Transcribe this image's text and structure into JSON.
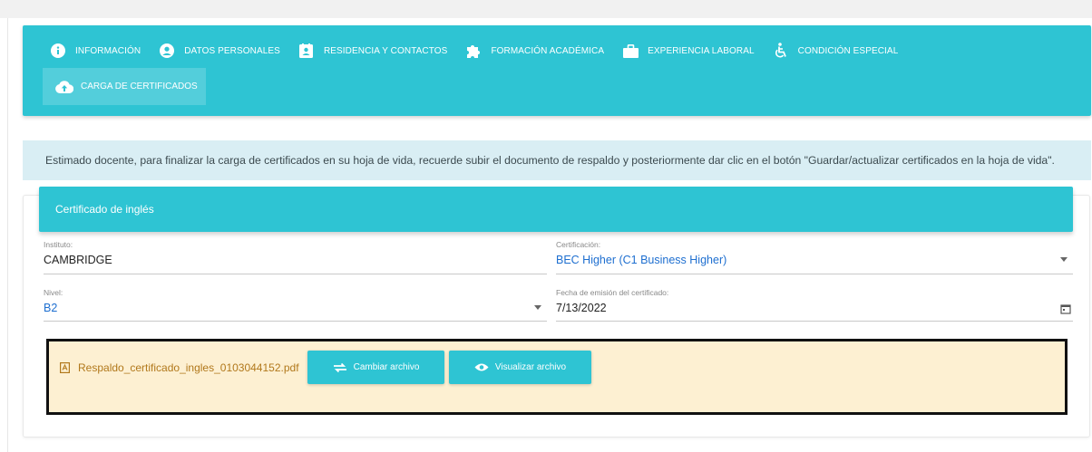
{
  "nav": {
    "tabs": [
      {
        "label": "INFORMACIÓN",
        "icon": "info-circle-icon"
      },
      {
        "label": "DATOS PERSONALES",
        "icon": "user-circle-icon"
      },
      {
        "label": "RESIDENCIA Y CONTACTOS",
        "icon": "contact-card-icon"
      },
      {
        "label": "FORMACIÓN ACADÉMICA",
        "icon": "puzzle-icon"
      },
      {
        "label": "EXPERIENCIA LABORAL",
        "icon": "briefcase-icon"
      },
      {
        "label": "CONDICIÓN ESPECIAL",
        "icon": "wheelchair-icon"
      }
    ],
    "active_tab": {
      "label": "CARGA DE CERTIFICADOS",
      "icon": "cloud-upload-icon"
    }
  },
  "alert": {
    "text": "Estimado docente, para finalizar la carga de certificados en su hoja de vida, recuerde subir el documento de respaldo y posteriormente dar clic en el botón \"Guardar/actualizar certificados en la hoja de vida\"."
  },
  "card": {
    "title": "Certificado de inglés",
    "instituto": {
      "label": "Instituto:",
      "value": "CAMBRIDGE"
    },
    "certificacion": {
      "label": "Certificación:",
      "value": "BEC Higher (C1 Business Higher)"
    },
    "nivel": {
      "label": "Nivel:",
      "value": "B2"
    },
    "fecha": {
      "label": "Fecha de emisión del certificado:",
      "value": "7/13/2022"
    }
  },
  "file": {
    "name": "Respaldo_certificado_ingles_0103044152.pdf",
    "change_label": "Cambiar archivo",
    "view_label": "Visualizar archivo"
  },
  "colors": {
    "primary": "#2ec4d3",
    "alert_bg": "#d9eef4",
    "file_bg": "#fdf0d2",
    "link_blue": "#1e6fd0",
    "file_text": "#b1781b"
  }
}
